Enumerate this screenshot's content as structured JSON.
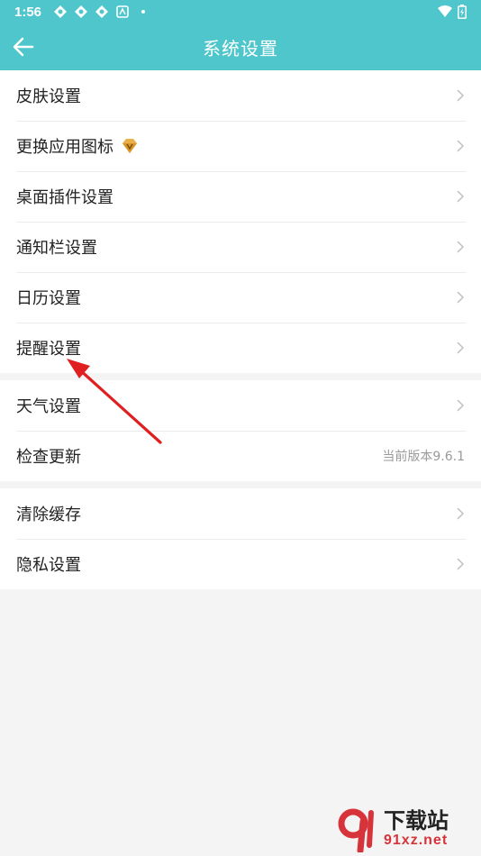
{
  "status_bar": {
    "time": "1:56",
    "icons": [
      "app-notification-icon",
      "app-notification-icon",
      "app-notification-icon",
      "a-icon",
      "dot-icon",
      "wifi-icon",
      "battery-icon"
    ]
  },
  "app_bar": {
    "title": "系统设置",
    "back_icon": "arrow-left-icon",
    "color": "#4ec6cc"
  },
  "groups": [
    {
      "items": [
        {
          "label": "皮肤设置"
        },
        {
          "label": "更换应用图标",
          "badge": "vip-diamond-icon"
        },
        {
          "label": "桌面插件设置"
        },
        {
          "label": "通知栏设置"
        },
        {
          "label": "日历设置"
        },
        {
          "label": "提醒设置"
        }
      ]
    },
    {
      "items": [
        {
          "label": "天气设置"
        },
        {
          "label": "检查更新",
          "value": "当前版本9.6.1"
        }
      ]
    },
    {
      "items": [
        {
          "label": "清除缓存"
        },
        {
          "label": "隐私设置"
        }
      ]
    }
  ],
  "annotation": {
    "color": "#e02020"
  },
  "watermark": {
    "top": "下载站",
    "bottom": "91xz.net"
  }
}
